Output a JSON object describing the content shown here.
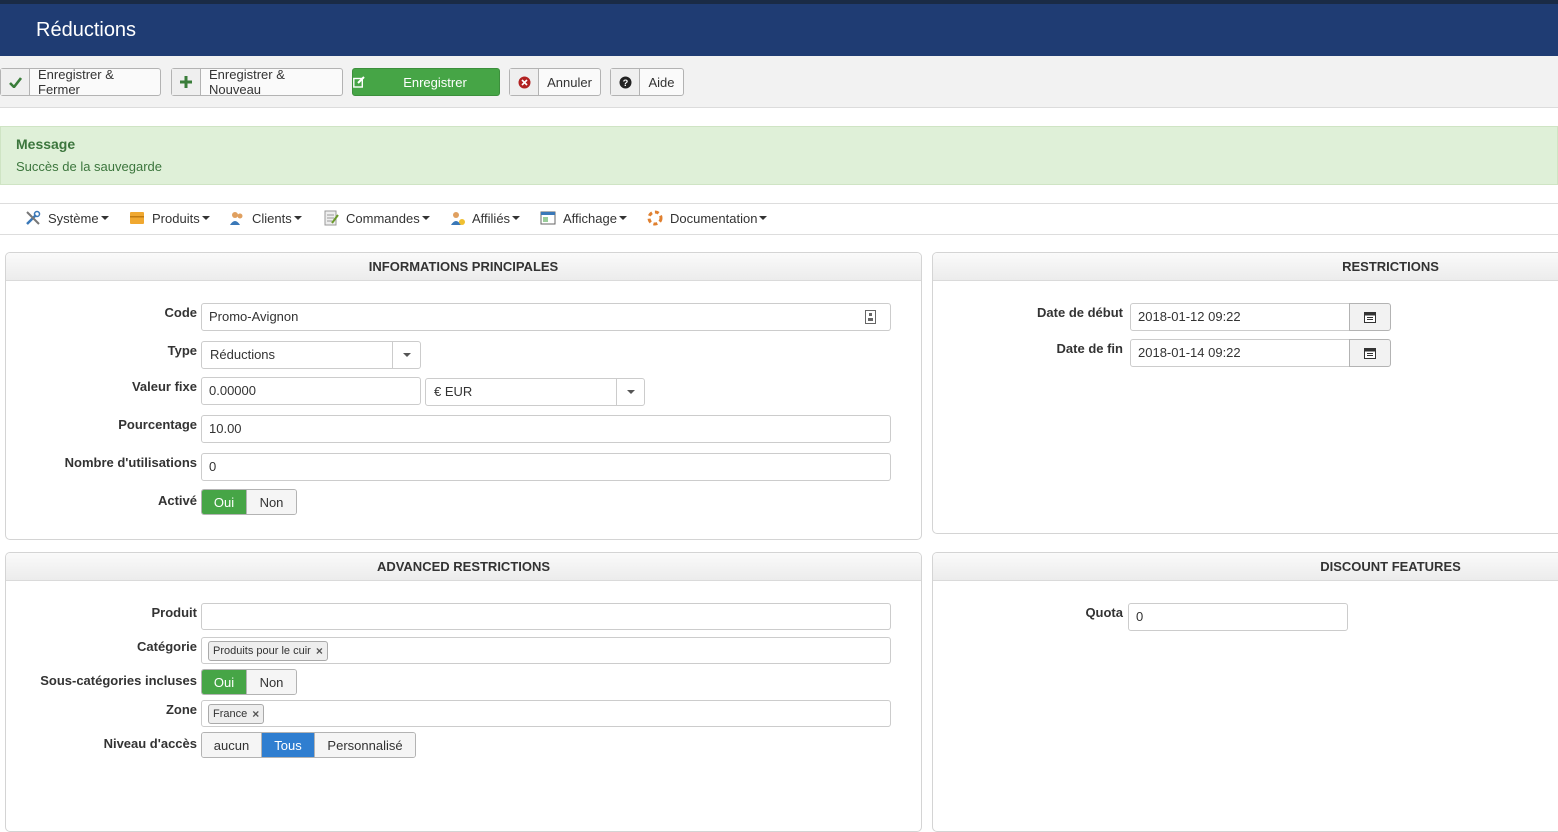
{
  "header": {
    "title": "Réductions"
  },
  "toolbar": {
    "save_close": "Enregistrer & Fermer",
    "save_new": "Enregistrer & Nouveau",
    "save": "Enregistrer",
    "cancel": "Annuler",
    "help": "Aide"
  },
  "message": {
    "heading": "Message",
    "text": "Succès de la sauvegarde"
  },
  "menu": {
    "systeme": "Système",
    "produits": "Produits",
    "clients": "Clients",
    "commandes": "Commandes",
    "affilies": "Affiliés",
    "affichage": "Affichage",
    "documentation": "Documentation"
  },
  "main_info": {
    "title": "INFORMATIONS PRINCIPALES",
    "code_label": "Code",
    "code_value": "Promo-Avignon",
    "type_label": "Type",
    "type_value": "Réductions",
    "fixed_label": "Valeur fixe",
    "fixed_value": "0.00000",
    "currency_value": "€ EUR",
    "percent_label": "Pourcentage",
    "percent_value": "10.00",
    "uses_label": "Nombre d'utilisations",
    "uses_value": "0",
    "active_label": "Activé",
    "yes": "Oui",
    "no": "Non"
  },
  "restrictions": {
    "title": "RESTRICTIONS",
    "start_label": "Date de début",
    "start_value": "2018-01-12 09:22",
    "end_label": "Date de fin",
    "end_value": "2018-01-14 09:22"
  },
  "advanced": {
    "title": "ADVANCED RESTRICTIONS",
    "product_label": "Produit",
    "category_label": "Catégorie",
    "category_tag": "Produits pour le cuir",
    "subcat_label": "Sous-catégories incluses",
    "yes": "Oui",
    "no": "Non",
    "zone_label": "Zone",
    "zone_tag": "France",
    "access_label": "Niveau d'accès",
    "access_none": "aucun",
    "access_all": "Tous",
    "access_custom": "Personnalisé"
  },
  "features": {
    "title": "DISCOUNT FEATURES",
    "quota_label": "Quota",
    "quota_value": "0"
  },
  "colors": {
    "header": "#1f3c73",
    "green": "#46a546",
    "blue": "#2f7ed0",
    "alert_bg": "#dff0d8"
  }
}
